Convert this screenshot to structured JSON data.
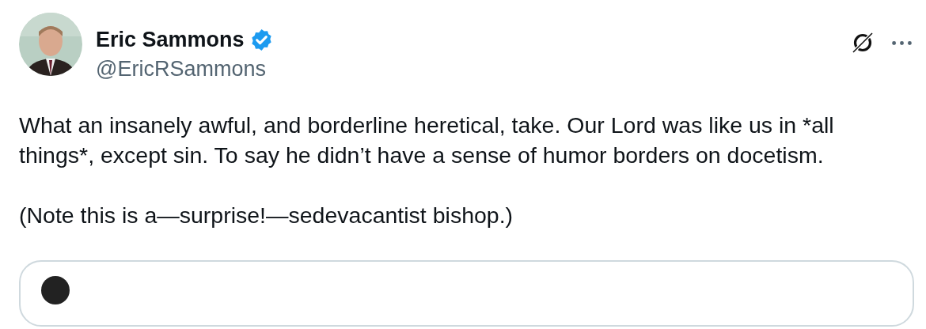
{
  "author": {
    "name": "Eric Sammons",
    "verified": true,
    "handle": "@EricRSammons"
  },
  "body": [
    "What an insanely awful, and borderline heretical, take. Our Lord was like us in *all things*, except sin. To say he didn’t have a sense of humor borders on docetism.",
    "(Note this is a—surprise!—sedevacantist bishop.)"
  ]
}
